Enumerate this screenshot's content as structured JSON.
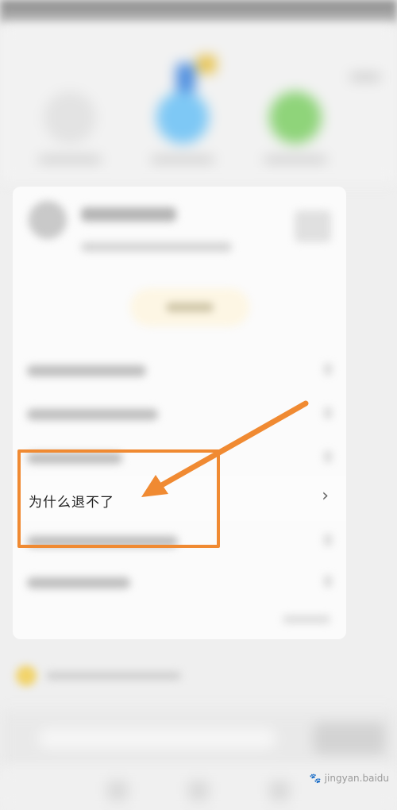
{
  "faq": {
    "question": "为什么退不了",
    "chevron": "›"
  },
  "annotation": {
    "color": "#f08a32",
    "shape": "arrow-and-box"
  },
  "watermark": {
    "paw": "🐾",
    "text": "jingyan.baidu"
  },
  "icons": {
    "chevron": "chevron-right-icon"
  }
}
